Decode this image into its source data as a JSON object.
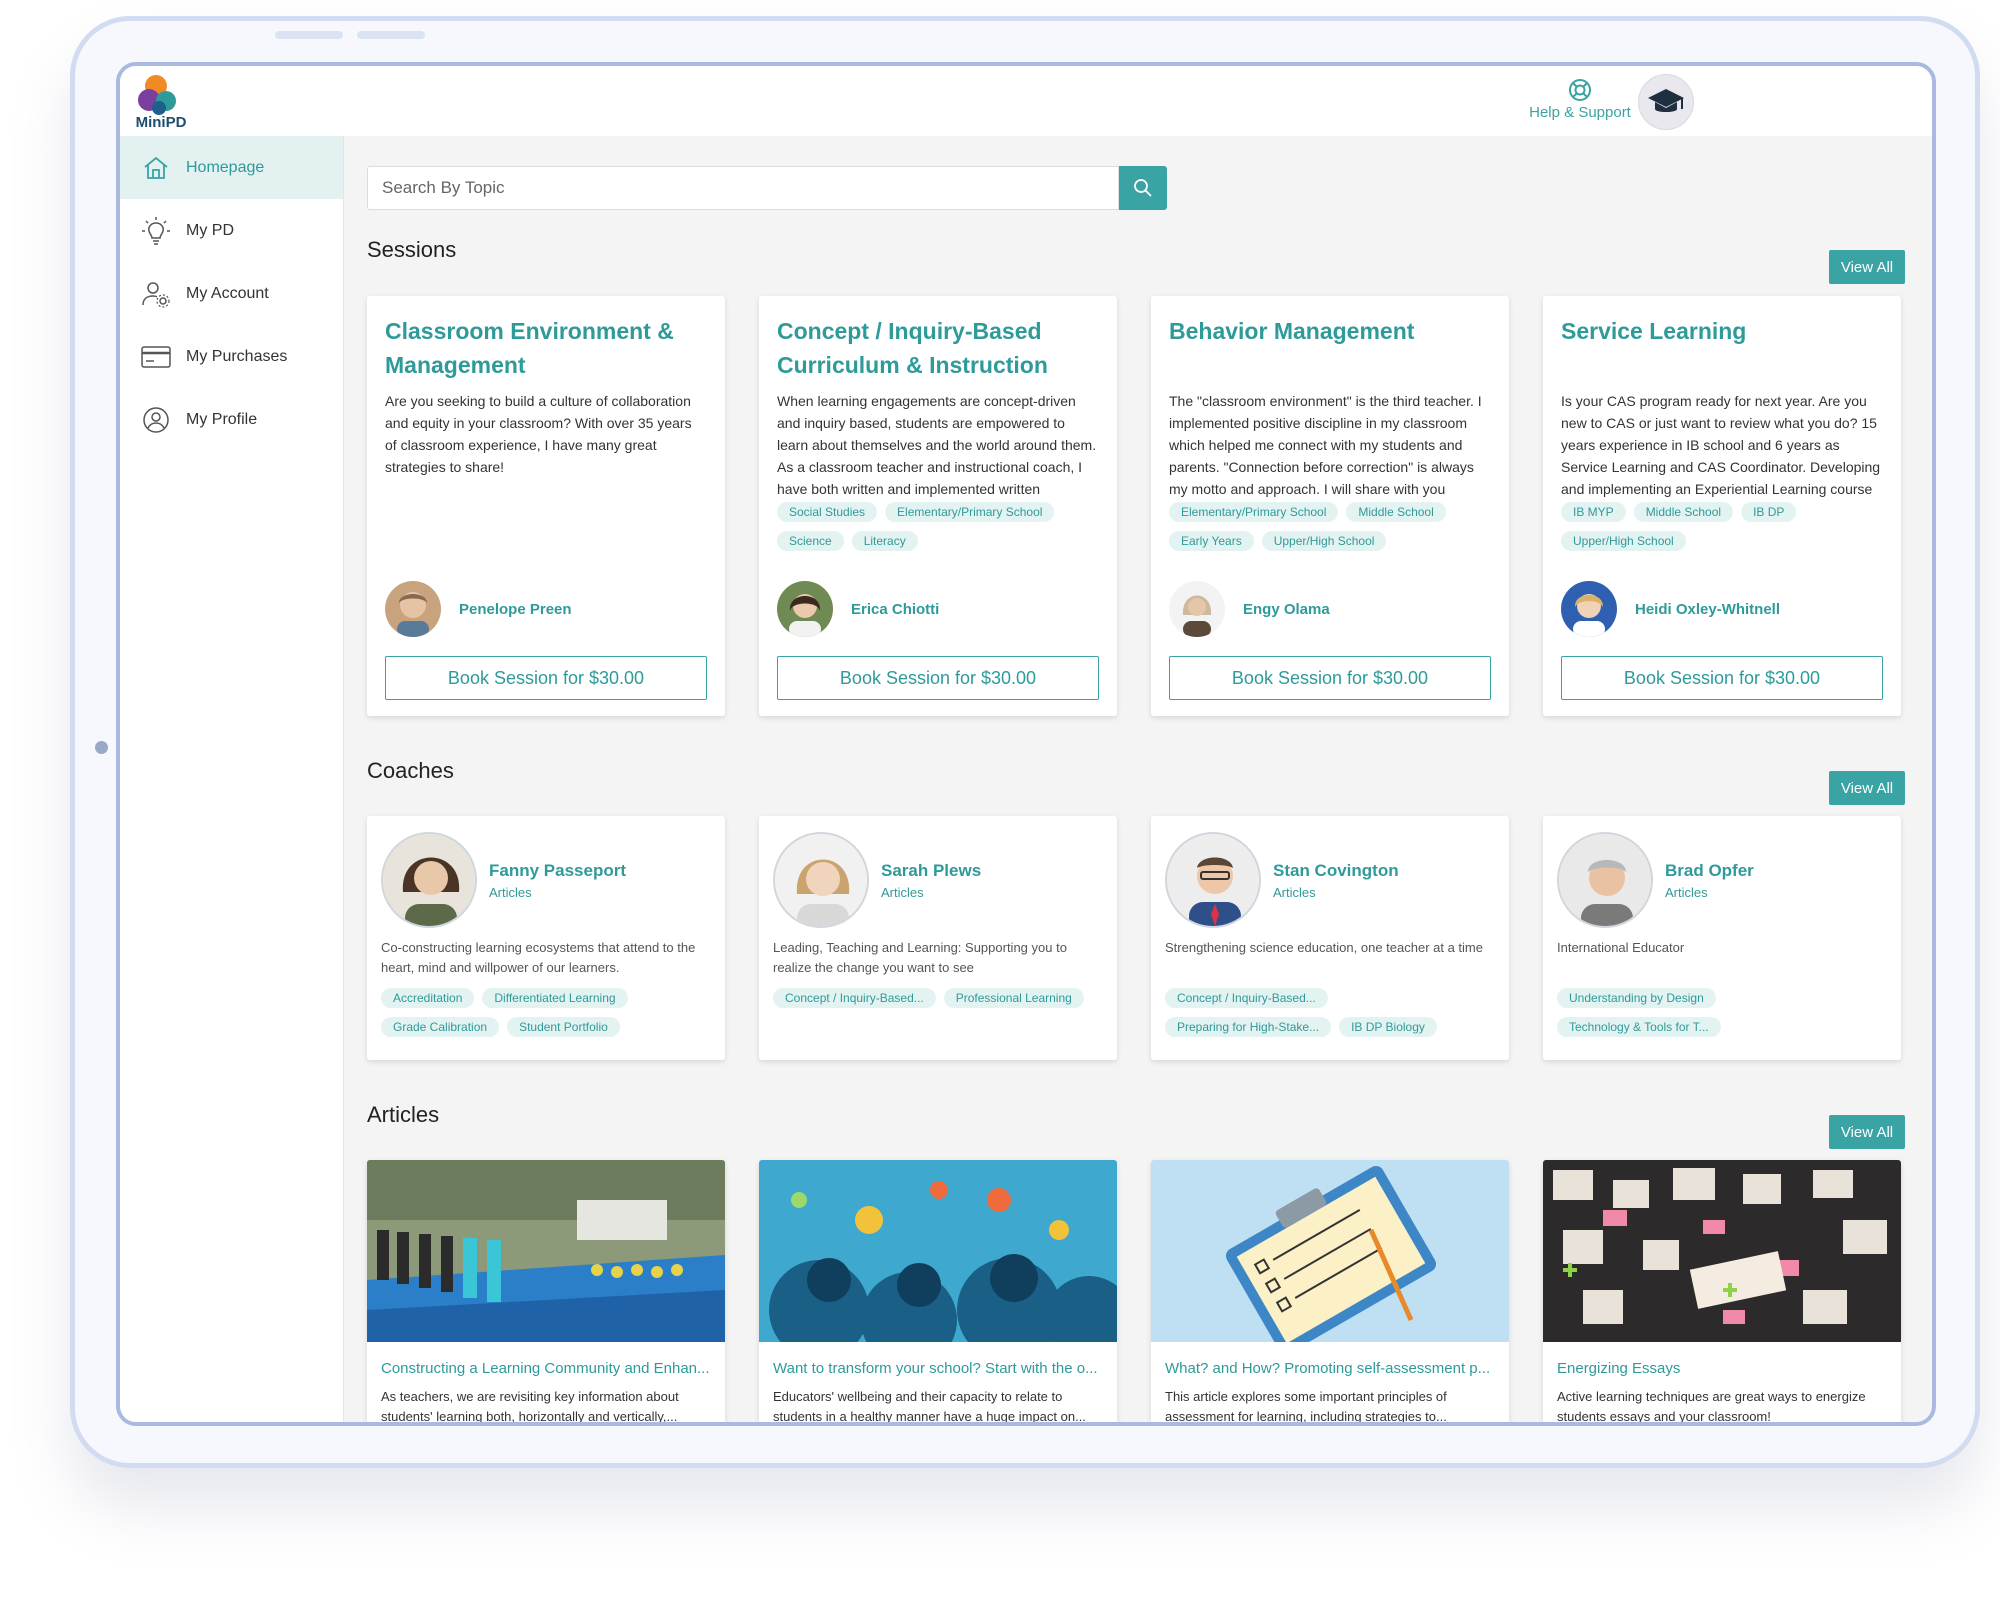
{
  "app": {
    "logo_text": "MiniPD"
  },
  "header": {
    "help_label": "Help & Support"
  },
  "sidebar": {
    "items": [
      {
        "label": "Homepage",
        "icon": "home-icon",
        "active": true
      },
      {
        "label": "My PD",
        "icon": "lightbulb-icon"
      },
      {
        "label": "My Account",
        "icon": "user-settings-icon"
      },
      {
        "label": "My Purchases",
        "icon": "credit-card-icon"
      },
      {
        "label": "My Profile",
        "icon": "user-circle-icon"
      }
    ]
  },
  "search": {
    "placeholder": "Search By Topic"
  },
  "sections": {
    "sessions": "Sessions",
    "coaches": "Coaches",
    "articles": "Articles",
    "view_all": "View All"
  },
  "sessions": [
    {
      "title": "Classroom Environment & Management",
      "desc": "Are you seeking to build a culture of collaboration and equity in your classroom? With over 35 years of classroom experience, I have many great strategies to share!",
      "tags": [],
      "author": "Penelope Preen",
      "button": "Book Session for $30.00"
    },
    {
      "title": "Concept / Inquiry-Based Curriculum & Instruction",
      "desc": "When learning engagements are concept-driven and inquiry based, students are empowered to learn about themselves and the world around them. As a classroom teacher and instructional coach, I have both written and implemented written curriculum that is relevant, engaging,...",
      "tags": [
        "Social Studies",
        "Elementary/Primary School",
        "Science",
        "Literacy"
      ],
      "author": "Erica Chiotti",
      "button": "Book Session for $30.00"
    },
    {
      "title": "Behavior Management",
      "desc": "The \"classroom environment\" is the third teacher. I implemented positive discipline in my classroom which helped me connect with my students and parents. \"Connection before correction\" is always my motto and approach. I will share with you effective strategies and tips.",
      "tags": [
        "Elementary/Primary School",
        "Middle School",
        "Early Years",
        "Upper/High School"
      ],
      "author": "Engy Olama",
      "button": "Book Session for $30.00"
    },
    {
      "title": "Service Learning",
      "desc": "Is your CAS program ready for next year. Are you new to CAS or just want to review what you do? 15 years experience in IB school and 6 years as Service Learning and CAS Coordinator. Developing and implementing an Experiential Learning course for the middle school, and...",
      "tags": [
        "IB MYP",
        "Middle School",
        "IB DP",
        "Upper/High School"
      ],
      "author": "Heidi Oxley-Whitnell",
      "button": "Book Session for $30.00"
    }
  ],
  "coaches": [
    {
      "name": "Fanny Passeport",
      "sub": "Articles",
      "desc": "Co-constructing learning ecosystems that attend to the heart, mind and willpower of our learners.",
      "tags": [
        "Accreditation",
        "Differentiated Learning",
        "Grade Calibration",
        "Student Portfolio"
      ]
    },
    {
      "name": "Sarah Plews",
      "sub": "Articles",
      "desc": "Leading, Teaching and Learning: Supporting you to realize the change you want to see",
      "tags": [
        "Concept / Inquiry-Based...",
        "Professional Learning"
      ]
    },
    {
      "name": "Stan Covington",
      "sub": "Articles",
      "desc": "Strengthening science education, one teacher at a time",
      "tags": [
        "Concept / Inquiry-Based...",
        "Preparing for High-Stake...",
        "IB DP Biology"
      ]
    },
    {
      "name": "Brad Opfer",
      "sub": "Articles",
      "desc": "International Educator",
      "tags": [
        "Understanding by Design",
        "Technology & Tools for T..."
      ]
    }
  ],
  "articles": [
    {
      "title": "Constructing a Learning Community and Enhan...",
      "desc": "As teachers, we are revisiting key information about students' learning both, horizontally and vertically,..."
    },
    {
      "title": "Want to transform your school? Start with the o...",
      "desc": "Educators' wellbeing and their capacity to relate to students in a healthy manner have a huge impact on..."
    },
    {
      "title": "What? and How? Promoting self-assessment p...",
      "desc": "This article explores some important principles of assessment for learning, including strategies to..."
    },
    {
      "title": "Energizing Essays",
      "desc": "Active learning techniques are great ways to energize students essays and your classroom!"
    }
  ],
  "colors": {
    "accent": "#3aa3a3",
    "accent_light": "#e3f2f1"
  }
}
